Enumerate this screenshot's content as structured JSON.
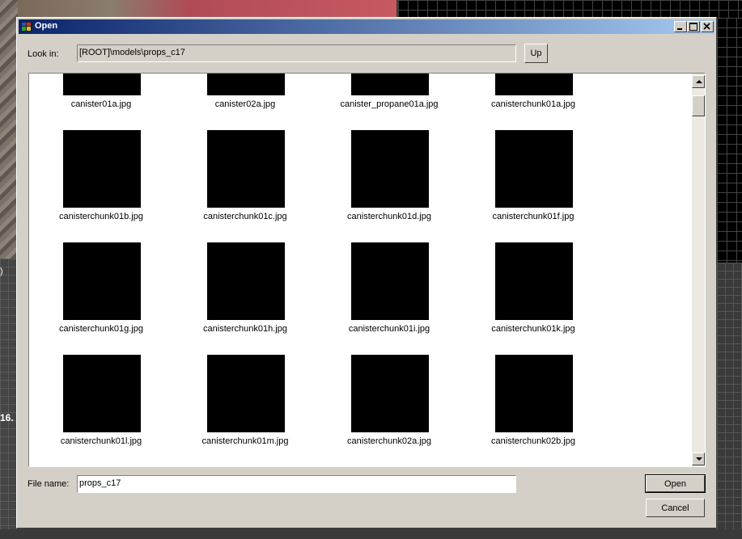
{
  "background": {
    "left_number": "16.",
    "left_paren": ")"
  },
  "dialog": {
    "title": "Open",
    "look_in_label": "Look in:",
    "look_in_value": "[ROOT]\\models\\props_c17",
    "up_label": "Up",
    "file_name_label": "File name:",
    "file_name_value": "props_c17",
    "open_label": "Open",
    "cancel_label": "Cancel"
  },
  "files": [
    "canister01a.jpg",
    "canister02a.jpg",
    "canister_propane01a.jpg",
    "canisterchunk01a.jpg",
    "canisterchunk01b.jpg",
    "canisterchunk01c.jpg",
    "canisterchunk01d.jpg",
    "canisterchunk01f.jpg",
    "canisterchunk01g.jpg",
    "canisterchunk01h.jpg",
    "canisterchunk01i.jpg",
    "canisterchunk01k.jpg",
    "canisterchunk01l.jpg",
    "canisterchunk01m.jpg",
    "canisterchunk02a.jpg",
    "canisterchunk02b.jpg"
  ],
  "icons": {
    "app": "app-icon",
    "minimize": "minimize-icon",
    "maximize": "maximize-icon",
    "close": "close-icon",
    "scroll_up": "scroll-up-icon",
    "scroll_down": "scroll-down-icon"
  },
  "colors": {
    "titlebar_start": "#0a246a",
    "titlebar_end": "#a6caf0",
    "dialog": "#d4d0c8",
    "thumbnail": "#000000"
  }
}
